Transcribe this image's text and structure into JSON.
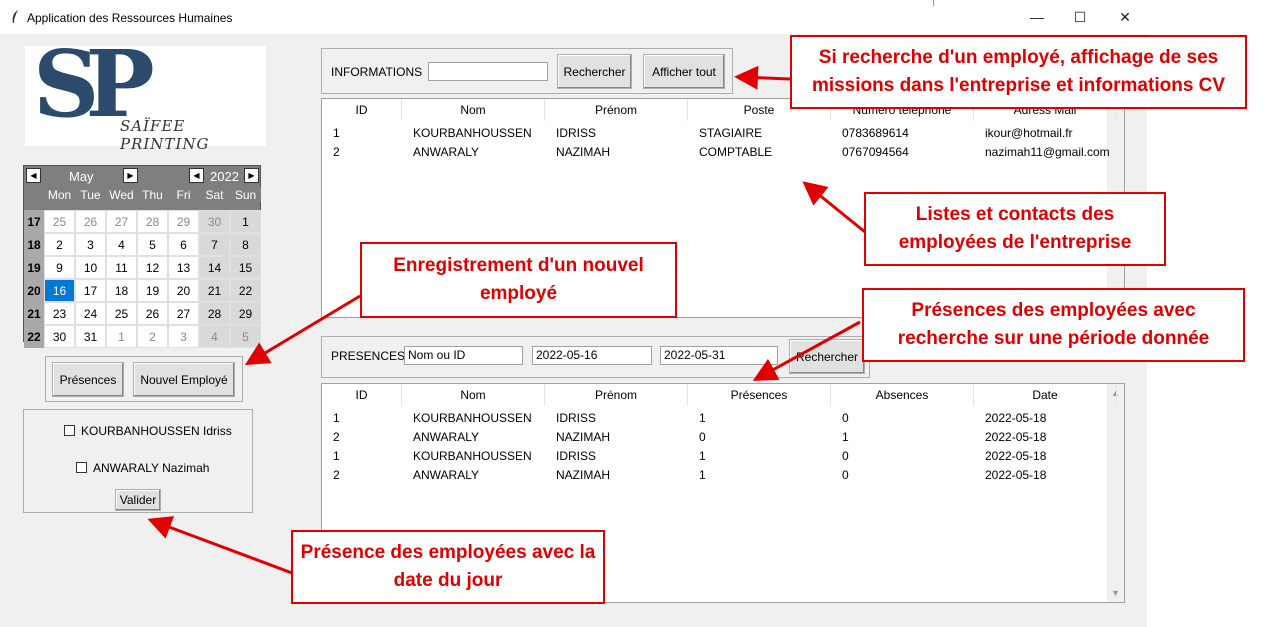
{
  "window": {
    "title": "Application des Ressources Humaines",
    "minimize": "—",
    "maximize": "☐",
    "close": "✕"
  },
  "logo": {
    "initials": "SP",
    "name": "SAÏFEE PRINTING"
  },
  "calendar": {
    "month": "May",
    "year": "2022",
    "days_of_week": [
      "Mon",
      "Tue",
      "Wed",
      "Thu",
      "Fri",
      "Sat",
      "Sun"
    ],
    "weeks": [
      {
        "wk": "17",
        "days": [
          "25",
          "26",
          "27",
          "28",
          "29",
          "30",
          "1"
        ]
      },
      {
        "wk": "18",
        "days": [
          "2",
          "3",
          "4",
          "5",
          "6",
          "7",
          "8"
        ]
      },
      {
        "wk": "19",
        "days": [
          "9",
          "10",
          "11",
          "12",
          "13",
          "14",
          "15"
        ]
      },
      {
        "wk": "20",
        "days": [
          "16",
          "17",
          "18",
          "19",
          "20",
          "21",
          "22"
        ]
      },
      {
        "wk": "21",
        "days": [
          "23",
          "24",
          "25",
          "26",
          "27",
          "28",
          "29"
        ]
      },
      {
        "wk": "22",
        "days": [
          "30",
          "31",
          "1",
          "2",
          "3",
          "4",
          "5"
        ]
      }
    ],
    "selected": "16"
  },
  "left_buttons": {
    "presences": "Présences",
    "new_employee": "Nouvel Employé"
  },
  "attendance_check": {
    "employees": [
      "KOURBANHOUSSEN Idriss",
      "ANWARALY Nazimah"
    ],
    "validate": "Valider"
  },
  "informations": {
    "label": "INFORMATIONS",
    "search_value": "",
    "search_button": "Rechercher",
    "show_all_button": "Afficher tout"
  },
  "employees_table": {
    "columns": [
      "ID",
      "Nom",
      "Prénom",
      "Poste",
      "Numéro telephone",
      "Adress Mail"
    ],
    "rows": [
      [
        "1",
        "KOURBANHOUSSEN",
        "IDRISS",
        "STAGIAIRE",
        "0783689614",
        "ikour@hotmail.fr"
      ],
      [
        "2",
        "ANWARALY",
        "NAZIMAH",
        "COMPTABLE",
        "0767094564",
        "nazimah11@gmail.com"
      ]
    ]
  },
  "presences": {
    "label": "PRESENCES",
    "name_or_id": "Nom ou ID",
    "date_from": "2022-05-16",
    "date_to": "2022-05-31",
    "search_button": "Rechercher"
  },
  "presences_table": {
    "columns": [
      "ID",
      "Nom",
      "Prénom",
      "Présences",
      "Absences",
      "Date"
    ],
    "rows": [
      [
        "1",
        "KOURBANHOUSSEN",
        "IDRISS",
        "1",
        "0",
        "2022-05-18"
      ],
      [
        "2",
        "ANWARALY",
        "NAZIMAH",
        "0",
        "1",
        "2022-05-18"
      ],
      [
        "1",
        "KOURBANHOUSSEN",
        "IDRISS",
        "1",
        "0",
        "2022-05-18"
      ],
      [
        "2",
        "ANWARALY",
        "NAZIMAH",
        "1",
        "0",
        "2022-05-18"
      ]
    ]
  },
  "annotations": {
    "search": "Si recherche d'un employé, affichage de ses missions dans l'entreprise et informations CV",
    "list": "Listes et contacts des employées de l'entreprise",
    "new": "Enregistrement d'un nouvel employé",
    "presence_period": "Présences des employées avec recherche sur une période donnée",
    "presence_today": "Présence des employées avec la date du jour"
  },
  "colors": {
    "annotation": "#e00000",
    "selected_day": "#0078d7",
    "logo": "#2c4a6b"
  }
}
